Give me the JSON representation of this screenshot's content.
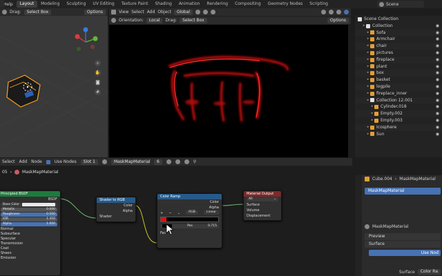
{
  "topbar": {
    "help": "Help",
    "tabs": [
      "Layout",
      "Modeling",
      "Sculpting",
      "UV Editing",
      "Texture Paint",
      "Shading",
      "Animation",
      "Rendering",
      "Compositing",
      "Geometry Nodes",
      "Scripting"
    ],
    "active_tab": "Layout",
    "scene": "Scene"
  },
  "viewport_left": {
    "drag_label": "Drag:",
    "drag_value": "Select Box",
    "options": "Options"
  },
  "viewport_right": {
    "menus": [
      "View",
      "Select",
      "Add",
      "Object"
    ],
    "transform": "Global",
    "orientation_label": "Orientation:",
    "orientation_value": "Local",
    "drag_label": "Drag:",
    "drag_value": "Select Box",
    "options": "Options"
  },
  "outliner": {
    "root": "Scene Collection",
    "rows": [
      {
        "name": "Collection",
        "kind": "collection",
        "indent": 1
      },
      {
        "name": "Sofa",
        "kind": "object",
        "indent": 2
      },
      {
        "name": "Armchair",
        "kind": "object",
        "indent": 2
      },
      {
        "name": "chair",
        "kind": "object",
        "indent": 2
      },
      {
        "name": "pictures",
        "kind": "object",
        "indent": 2
      },
      {
        "name": "fireplace",
        "kind": "object",
        "indent": 2
      },
      {
        "name": "plant",
        "kind": "object",
        "indent": 2
      },
      {
        "name": "box",
        "kind": "object",
        "indent": 2
      },
      {
        "name": "basket",
        "kind": "object",
        "indent": 2
      },
      {
        "name": "logpile",
        "kind": "object",
        "indent": 2
      },
      {
        "name": "fireplace_inner",
        "kind": "object",
        "indent": 2
      },
      {
        "name": "Collection 12.001",
        "kind": "collection",
        "indent": 2
      },
      {
        "name": "Cylinder.018",
        "kind": "object",
        "indent": 3
      },
      {
        "name": "Empty.002",
        "kind": "object",
        "indent": 3
      },
      {
        "name": "Empty.003",
        "kind": "object",
        "indent": 3
      },
      {
        "name": "Icosphere",
        "kind": "object",
        "indent": 2
      },
      {
        "name": "Sun",
        "kind": "object",
        "indent": 2
      }
    ]
  },
  "node_header": {
    "menus": [
      "Select",
      "Add",
      "Node"
    ],
    "use_nodes": "Use Nodes",
    "slot": "Slot 1",
    "material": "MaskMapMaterial",
    "users": "6"
  },
  "breadcrumb": {
    "prefix": "05",
    "material": "MaskMapMaterial"
  },
  "nodes": {
    "bsdf": {
      "title": "Principled BSDF",
      "output": "BSDF",
      "fields": [
        {
          "label": "Base Color",
          "value": ""
        },
        {
          "label": "Metallic",
          "value": "0.000"
        },
        {
          "label": "Roughness",
          "value": "0.500"
        },
        {
          "label": "IOR",
          "value": "1.450"
        },
        {
          "label": "Alpha",
          "value": "1.000"
        }
      ],
      "sections": [
        "Normal",
        "Subsurface",
        "Specular",
        "Transmission",
        "Coat",
        "Sheen",
        "Emission"
      ]
    },
    "shader_rgb": {
      "title": "Shader to RGB",
      "outputs": [
        "Color",
        "Alpha"
      ],
      "input": "Shader"
    },
    "color_ramp": {
      "title": "Color Ramp",
      "outputs": [
        "Color",
        "Alpha"
      ],
      "mode": "RGB",
      "interp": "Linear",
      "pos_label": "Pos",
      "pos_value": "0.715",
      "input": "Fac"
    },
    "material_output": {
      "title": "Material Output",
      "target": "All",
      "inputs": [
        "Surface",
        "Volume",
        "Displacement"
      ]
    }
  },
  "properties": {
    "object": "Cube.004",
    "material": "MaskMapMaterial",
    "slot_material": "MaskMapMaterial",
    "material_field": "MaskMapMaterial",
    "preview": "Preview",
    "surface": "Surface",
    "use_nodes": "Use Nod",
    "surface_label": "Surface",
    "surface_value": "Color Ra"
  },
  "colors": {
    "node_bsdf": "#1e7a3c",
    "node_shader": "#265a8a",
    "node_ramp": "#265a8a",
    "node_output": "#7a2a2a",
    "accent": "#4772b3",
    "render_red": "#e01010"
  }
}
